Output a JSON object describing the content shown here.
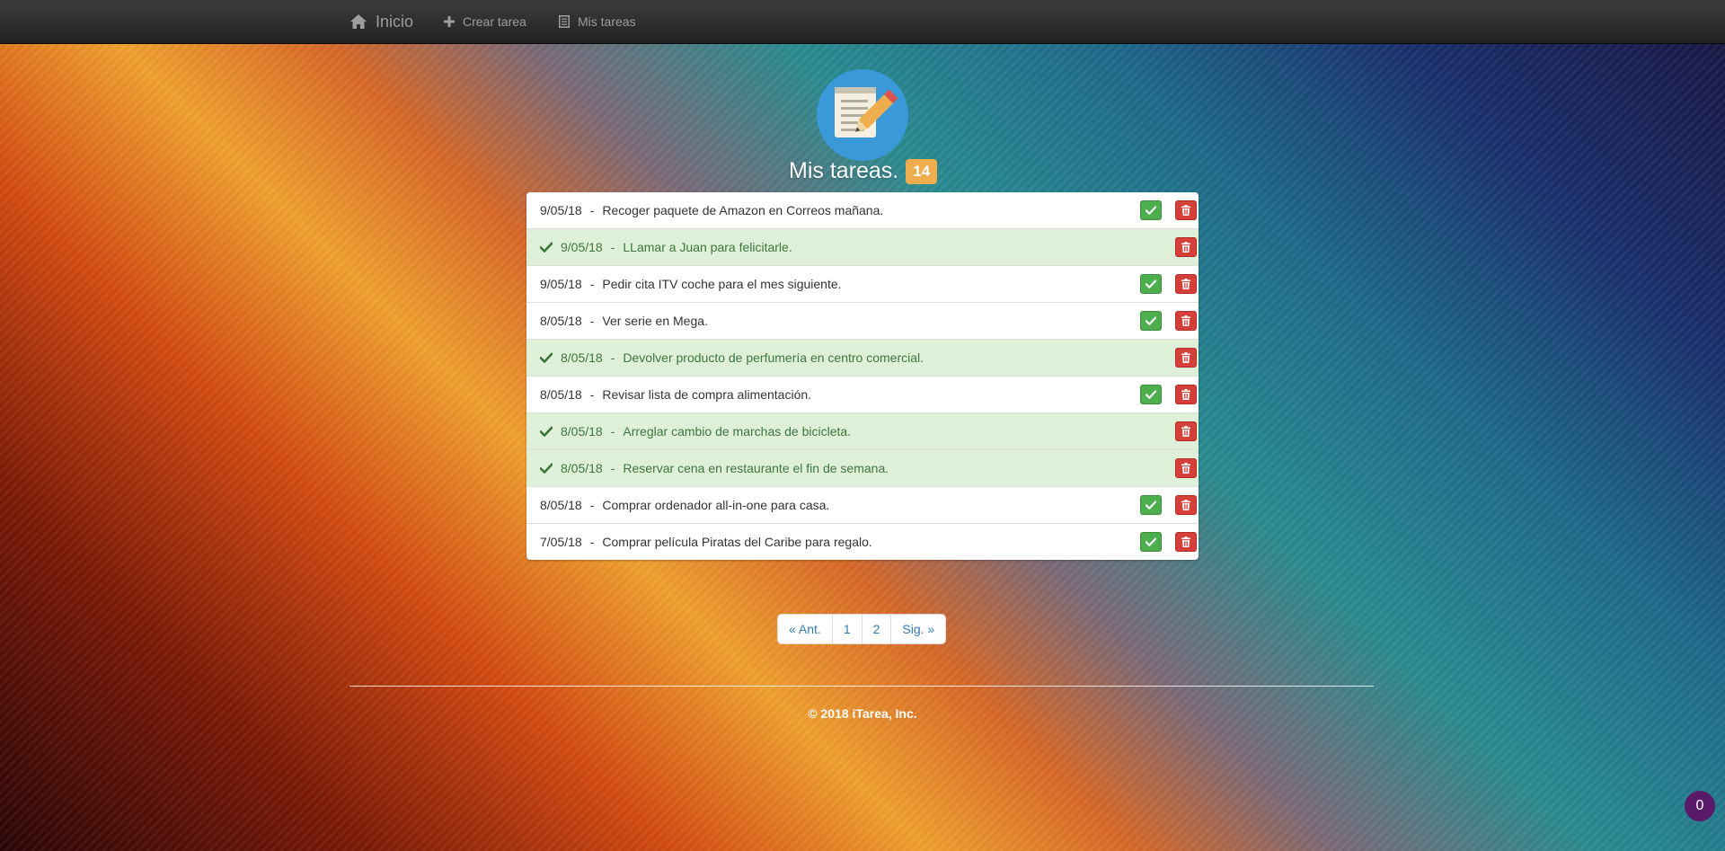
{
  "nav": {
    "home_label": "Inicio",
    "create_label": "Crear tarea",
    "list_label": "Mis tareas"
  },
  "header": {
    "title": "Mis tareas.",
    "count": "14"
  },
  "tasks": [
    {
      "date": "9/05/18",
      "text": "Recoger paquete de Amazon en Correos mañana.",
      "done": false
    },
    {
      "date": "9/05/18",
      "text": "LLamar a Juan para felicitarle.",
      "done": true
    },
    {
      "date": "9/05/18",
      "text": "Pedir cita ITV coche para el mes siguiente.",
      "done": false
    },
    {
      "date": "8/05/18",
      "text": "Ver serie en Mega.",
      "done": false
    },
    {
      "date": "8/05/18",
      "text": "Devolver producto de perfumería en centro comercial.",
      "done": true
    },
    {
      "date": "8/05/18",
      "text": "Revisar lista de compra alimentación.",
      "done": false
    },
    {
      "date": "8/05/18",
      "text": "Arreglar cambio de marchas de bicicleta.",
      "done": true
    },
    {
      "date": "8/05/18",
      "text": "Reservar cena en restaurante el fin de semana.",
      "done": true
    },
    {
      "date": "8/05/18",
      "text": "Comprar ordenador all-in-one para casa.",
      "done": false
    },
    {
      "date": "7/05/18",
      "text": "Comprar película Piratas del Caribe para regalo.",
      "done": false
    }
  ],
  "separator": "-",
  "pagination": {
    "prev": "« Ant.",
    "pages": [
      "1",
      "2"
    ],
    "next": "Sig. »"
  },
  "footer": {
    "copyright": "© 2018 iTarea, Inc."
  },
  "counter": {
    "value": "0"
  },
  "colors": {
    "done_row": "#dff0d8",
    "done_text": "#3c763d",
    "ok_button": "#4cae4c",
    "delete_button": "#d43f3a",
    "badge": "#f0ad4e",
    "link": "#337ab7"
  },
  "icons": {
    "home": "home-icon",
    "create": "plus-icon",
    "list": "list-icon",
    "logo": "notepad-pencil-icon",
    "done": "check-icon",
    "complete_button": "check-icon",
    "delete_button": "trash-icon"
  }
}
